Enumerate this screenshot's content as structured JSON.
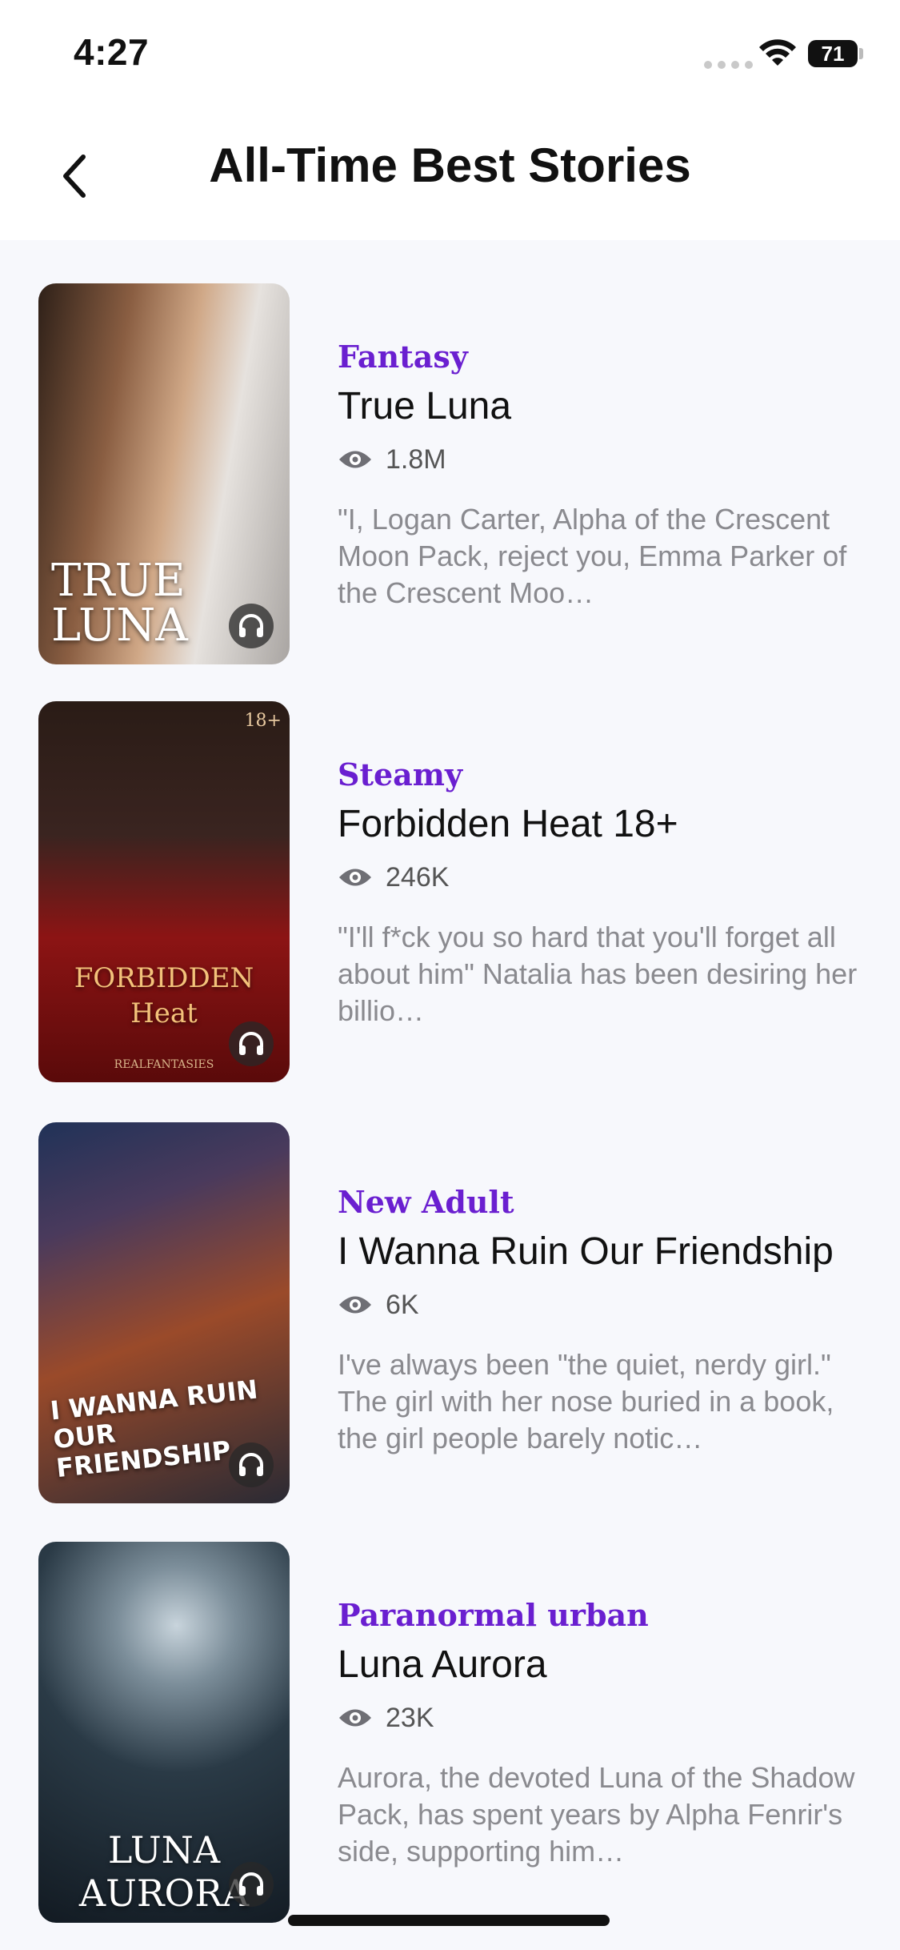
{
  "status": {
    "time": "4:27",
    "battery": "71"
  },
  "nav": {
    "title": "All-Time Best Stories"
  },
  "stories": [
    {
      "genre": "Fantasy",
      "title": "True Luna",
      "views": "1.8M",
      "blurb": "\"I, Logan Carter, Alpha of the Crescent Moon Pack, reject you, Emma Parker of the Crescent Moo…",
      "cover_text": "TRUE LUNA",
      "colors": [
        "#3b2a20",
        "#c59b7a",
        "#d9d4cf"
      ]
    },
    {
      "genre": "Steamy",
      "title": "Forbidden Heat 18+",
      "views": "246K",
      "blurb": "\"I'll f*ck you so hard that you'll forget all about him\" Natalia has been desiring her billio…",
      "cover_text": "FORBIDDEN Heat",
      "cover_badge": "18+",
      "cover_author": "REALFANTASIES",
      "colors": [
        "#1a1412",
        "#5a1010",
        "#b41a1a"
      ]
    },
    {
      "genre": "New Adult",
      "title": "I Wanna Ruin Our Friendship",
      "views": "6K",
      "blurb": "I've always been \"the quiet, nerdy girl.\" The girl with her nose buried in a book, the girl people barely notic…",
      "cover_text": "I WANNA RUIN OUR FRIENDSHIP",
      "colors": [
        "#1d2a4a",
        "#8a3a28",
        "#e0a24a"
      ]
    },
    {
      "genre": "Paranormal urban",
      "title": "Luna Aurora",
      "views": "23K",
      "blurb": "Aurora, the devoted Luna of the Shadow Pack, has spent years by Alpha Fenrir's side, supporting him…",
      "cover_text": "LUNA AURORA",
      "colors": [
        "#16222c",
        "#3c5060",
        "#8aa0ac"
      ]
    }
  ]
}
